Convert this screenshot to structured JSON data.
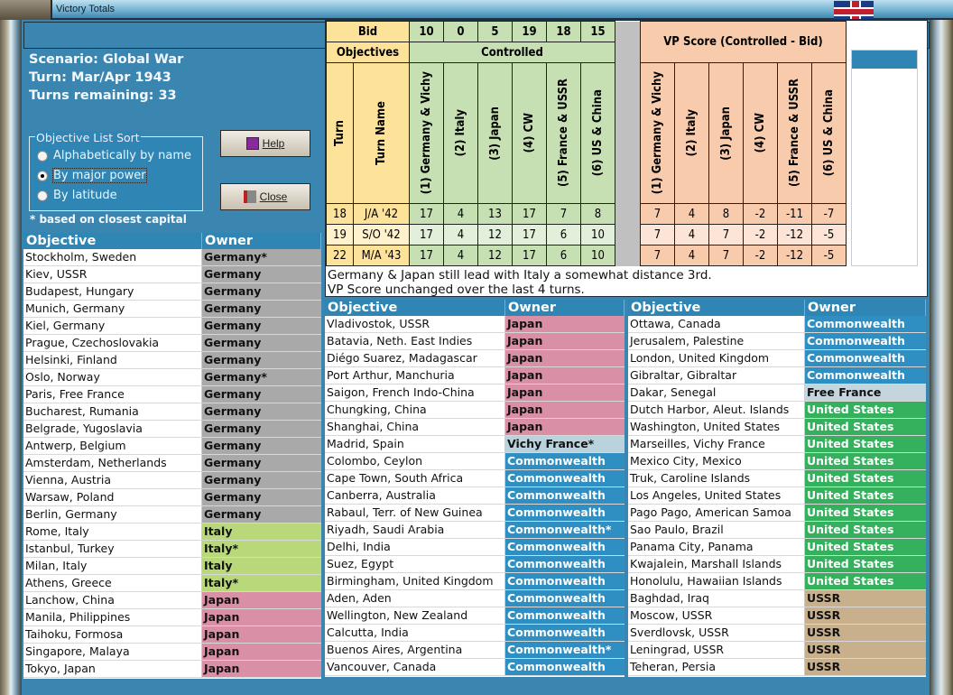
{
  "window": {
    "title": "Victory Totals"
  },
  "info": {
    "scenario": "Scenario: Global War",
    "turn": "Turn: Mar/Apr 1943",
    "remaining": "Turns remaining: 33"
  },
  "sort": {
    "legend": "Objective List Sort",
    "options": [
      "Alphabetically by name",
      "By major power",
      "By latitude"
    ],
    "selected": 1
  },
  "buttons": {
    "help": "Help",
    "close": "Close"
  },
  "note": "* based on closest capital",
  "colors": {
    "Germany": "#a9a9a9",
    "Italy": "#b9d879",
    "Japan": "#d98fa6",
    "Commonwealth": "#2f8ec2",
    "Free France": "#c5d5de",
    "United States": "#35b05c",
    "USSR": "#c9b08d",
    "Vichy France": "#b9d2dc"
  },
  "headers": {
    "objective": "Objective",
    "owner": "Owner"
  },
  "sheet": {
    "bid_label": "Bid",
    "bids": [
      "10",
      "0",
      "5",
      "19",
      "18",
      "15"
    ],
    "objectives_label": "Objectives",
    "controlled_label": "Controlled",
    "vp_label": "VP Score (Controlled - Bid)",
    "turn_label": "Turn",
    "turn_name_label": "Turn Name",
    "powers": [
      "(1) Germany & Vichy",
      "(2) Italy",
      "(3) Japan",
      "(4) CW",
      "(5) France & USSR",
      "(6) US & China"
    ],
    "rows": [
      {
        "turn": "18",
        "name": "J/A '42",
        "controlled": [
          "17",
          "4",
          "13",
          "17",
          "7",
          "8"
        ],
        "vp": [
          "7",
          "4",
          "8",
          "-2",
          "-11",
          "-7"
        ]
      },
      {
        "turn": "19",
        "name": "S/O '42",
        "controlled": [
          "17",
          "4",
          "12",
          "17",
          "6",
          "10"
        ],
        "vp": [
          "7",
          "4",
          "7",
          "-2",
          "-12",
          "-5"
        ]
      },
      {
        "turn": "22",
        "name": "M/A '43",
        "controlled": [
          "17",
          "4",
          "12",
          "17",
          "6",
          "10"
        ],
        "vp": [
          "7",
          "4",
          "7",
          "-2",
          "-12",
          "-5"
        ]
      }
    ],
    "comment": [
      "Germany & Japan still lead with Italy a somewhat distance 3rd.",
      "VP Score unchanged over the last 4 turns."
    ]
  },
  "lists": [
    [
      [
        "Stockholm, Sweden",
        "Germany*",
        "Germany"
      ],
      [
        "Kiev, USSR",
        "Germany",
        "Germany"
      ],
      [
        "Budapest, Hungary",
        "Germany",
        "Germany"
      ],
      [
        "Munich, Germany",
        "Germany",
        "Germany"
      ],
      [
        "Kiel, Germany",
        "Germany",
        "Germany"
      ],
      [
        "Prague, Czechoslovakia",
        "Germany",
        "Germany"
      ],
      [
        "Helsinki, Finland",
        "Germany",
        "Germany"
      ],
      [
        "Oslo, Norway",
        "Germany*",
        "Germany"
      ],
      [
        "Paris, Free France",
        "Germany",
        "Germany"
      ],
      [
        "Bucharest, Rumania",
        "Germany",
        "Germany"
      ],
      [
        "Belgrade, Yugoslavia",
        "Germany",
        "Germany"
      ],
      [
        "Antwerp, Belgium",
        "Germany",
        "Germany"
      ],
      [
        "Amsterdam, Netherlands",
        "Germany",
        "Germany"
      ],
      [
        "Vienna, Austria",
        "Germany",
        "Germany"
      ],
      [
        "Warsaw, Poland",
        "Germany",
        "Germany"
      ],
      [
        "Berlin, Germany",
        "Germany",
        "Germany"
      ],
      [
        "Rome, Italy",
        "Italy",
        "Italy"
      ],
      [
        "Istanbul, Turkey",
        "Italy*",
        "Italy"
      ],
      [
        "Milan, Italy",
        "Italy",
        "Italy"
      ],
      [
        "Athens, Greece",
        "Italy*",
        "Italy"
      ],
      [
        "Lanchow, China",
        "Japan",
        "Japan"
      ],
      [
        "Manila, Philippines",
        "Japan",
        "Japan"
      ],
      [
        "Taihoku, Formosa",
        "Japan",
        "Japan"
      ],
      [
        "Singapore, Malaya",
        "Japan",
        "Japan"
      ],
      [
        "Tokyo, Japan",
        "Japan",
        "Japan"
      ]
    ],
    [
      [
        "Vladivostok, USSR",
        "Japan",
        "Japan"
      ],
      [
        "Batavia, Neth. East Indies",
        "Japan",
        "Japan"
      ],
      [
        "Diégo Suarez, Madagascar",
        "Japan",
        "Japan"
      ],
      [
        "Port Arthur, Manchuria",
        "Japan",
        "Japan"
      ],
      [
        "Saigon, French Indo-China",
        "Japan",
        "Japan"
      ],
      [
        "Chungking, China",
        "Japan",
        "Japan"
      ],
      [
        "Shanghai, China",
        "Japan",
        "Japan"
      ],
      [
        "Madrid, Spain",
        "Vichy France*",
        "Vichy France"
      ],
      [
        "Colombo, Ceylon",
        "Commonwealth",
        "Commonwealth"
      ],
      [
        "Cape Town, South Africa",
        "Commonwealth",
        "Commonwealth"
      ],
      [
        "Canberra, Australia",
        "Commonwealth",
        "Commonwealth"
      ],
      [
        "Rabaul, Terr. of New Guinea",
        "Commonwealth",
        "Commonwealth"
      ],
      [
        "Riyadh, Saudi Arabia",
        "Commonwealth*",
        "Commonwealth"
      ],
      [
        "Delhi, India",
        "Commonwealth",
        "Commonwealth"
      ],
      [
        "Suez, Egypt",
        "Commonwealth",
        "Commonwealth"
      ],
      [
        "Birmingham, United Kingdom",
        "Commonwealth",
        "Commonwealth"
      ],
      [
        "Aden, Aden",
        "Commonwealth",
        "Commonwealth"
      ],
      [
        "Wellington, New Zealand",
        "Commonwealth",
        "Commonwealth"
      ],
      [
        "Calcutta, India",
        "Commonwealth",
        "Commonwealth"
      ],
      [
        "Buenos Aires, Argentina",
        "Commonwealth*",
        "Commonwealth"
      ],
      [
        "Vancouver, Canada",
        "Commonwealth",
        "Commonwealth"
      ]
    ],
    [
      [
        "Ottawa, Canada",
        "Commonwealth",
        "Commonwealth"
      ],
      [
        "Jerusalem, Palestine",
        "Commonwealth",
        "Commonwealth"
      ],
      [
        "London, United Kingdom",
        "Commonwealth",
        "Commonwealth"
      ],
      [
        "Gibraltar, Gibraltar",
        "Commonwealth",
        "Commonwealth"
      ],
      [
        "Dakar, Senegal",
        "Free France",
        "Free France"
      ],
      [
        "Dutch Harbor, Aleut. Islands",
        "United States",
        "United States"
      ],
      [
        "Washington, United States",
        "United States",
        "United States"
      ],
      [
        "Marseilles, Vichy France",
        "United States",
        "United States"
      ],
      [
        "Mexico City, Mexico",
        "United States",
        "United States"
      ],
      [
        "Truk, Caroline Islands",
        "United States",
        "United States"
      ],
      [
        "Los Angeles, United States",
        "United States",
        "United States"
      ],
      [
        "Pago Pago, American Samoa",
        "United States",
        "United States"
      ],
      [
        "Sao Paulo, Brazil",
        "United States",
        "United States"
      ],
      [
        "Panama City, Panama",
        "United States",
        "United States"
      ],
      [
        "Kwajalein, Marshall Islands",
        "United States",
        "United States"
      ],
      [
        "Honolulu, Hawaiian Islands",
        "United States",
        "United States"
      ],
      [
        "Baghdad, Iraq",
        "USSR",
        "USSR"
      ],
      [
        "Moscow, USSR",
        "USSR",
        "USSR"
      ],
      [
        "Sverdlovsk, USSR",
        "USSR",
        "USSR"
      ],
      [
        "Leningrad, USSR",
        "USSR",
        "USSR"
      ],
      [
        "Teheran, Persia",
        "USSR",
        "USSR"
      ]
    ]
  ]
}
